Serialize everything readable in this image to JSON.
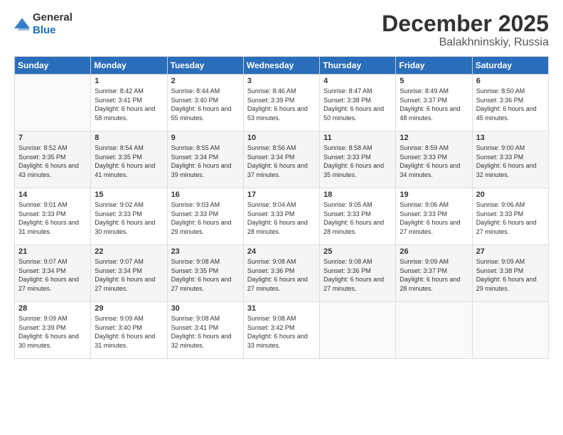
{
  "logo": {
    "general": "General",
    "blue": "Blue"
  },
  "header": {
    "month": "December 2025",
    "location": "Balakhninskiy, Russia"
  },
  "weekdays": [
    "Sunday",
    "Monday",
    "Tuesday",
    "Wednesday",
    "Thursday",
    "Friday",
    "Saturday"
  ],
  "weeks": [
    [
      {
        "day": "",
        "sunrise": "",
        "sunset": "",
        "daylight": ""
      },
      {
        "day": "1",
        "sunrise": "Sunrise: 8:42 AM",
        "sunset": "Sunset: 3:41 PM",
        "daylight": "Daylight: 6 hours and 58 minutes."
      },
      {
        "day": "2",
        "sunrise": "Sunrise: 8:44 AM",
        "sunset": "Sunset: 3:40 PM",
        "daylight": "Daylight: 6 hours and 55 minutes."
      },
      {
        "day": "3",
        "sunrise": "Sunrise: 8:46 AM",
        "sunset": "Sunset: 3:39 PM",
        "daylight": "Daylight: 6 hours and 53 minutes."
      },
      {
        "day": "4",
        "sunrise": "Sunrise: 8:47 AM",
        "sunset": "Sunset: 3:38 PM",
        "daylight": "Daylight: 6 hours and 50 minutes."
      },
      {
        "day": "5",
        "sunrise": "Sunrise: 8:49 AM",
        "sunset": "Sunset: 3:37 PM",
        "daylight": "Daylight: 6 hours and 48 minutes."
      },
      {
        "day": "6",
        "sunrise": "Sunrise: 8:50 AM",
        "sunset": "Sunset: 3:36 PM",
        "daylight": "Daylight: 6 hours and 45 minutes."
      }
    ],
    [
      {
        "day": "7",
        "sunrise": "Sunrise: 8:52 AM",
        "sunset": "Sunset: 3:35 PM",
        "daylight": "Daylight: 6 hours and 43 minutes."
      },
      {
        "day": "8",
        "sunrise": "Sunrise: 8:54 AM",
        "sunset": "Sunset: 3:35 PM",
        "daylight": "Daylight: 6 hours and 41 minutes."
      },
      {
        "day": "9",
        "sunrise": "Sunrise: 8:55 AM",
        "sunset": "Sunset: 3:34 PM",
        "daylight": "Daylight: 6 hours and 39 minutes."
      },
      {
        "day": "10",
        "sunrise": "Sunrise: 8:56 AM",
        "sunset": "Sunset: 3:34 PM",
        "daylight": "Daylight: 6 hours and 37 minutes."
      },
      {
        "day": "11",
        "sunrise": "Sunrise: 8:58 AM",
        "sunset": "Sunset: 3:33 PM",
        "daylight": "Daylight: 6 hours and 35 minutes."
      },
      {
        "day": "12",
        "sunrise": "Sunrise: 8:59 AM",
        "sunset": "Sunset: 3:33 PM",
        "daylight": "Daylight: 6 hours and 34 minutes."
      },
      {
        "day": "13",
        "sunrise": "Sunrise: 9:00 AM",
        "sunset": "Sunset: 3:33 PM",
        "daylight": "Daylight: 6 hours and 32 minutes."
      }
    ],
    [
      {
        "day": "14",
        "sunrise": "Sunrise: 9:01 AM",
        "sunset": "Sunset: 3:33 PM",
        "daylight": "Daylight: 6 hours and 31 minutes."
      },
      {
        "day": "15",
        "sunrise": "Sunrise: 9:02 AM",
        "sunset": "Sunset: 3:33 PM",
        "daylight": "Daylight: 6 hours and 30 minutes."
      },
      {
        "day": "16",
        "sunrise": "Sunrise: 9:03 AM",
        "sunset": "Sunset: 3:33 PM",
        "daylight": "Daylight: 6 hours and 29 minutes."
      },
      {
        "day": "17",
        "sunrise": "Sunrise: 9:04 AM",
        "sunset": "Sunset: 3:33 PM",
        "daylight": "Daylight: 6 hours and 28 minutes."
      },
      {
        "day": "18",
        "sunrise": "Sunrise: 9:05 AM",
        "sunset": "Sunset: 3:33 PM",
        "daylight": "Daylight: 6 hours and 28 minutes."
      },
      {
        "day": "19",
        "sunrise": "Sunrise: 9:06 AM",
        "sunset": "Sunset: 3:33 PM",
        "daylight": "Daylight: 6 hours and 27 minutes."
      },
      {
        "day": "20",
        "sunrise": "Sunrise: 9:06 AM",
        "sunset": "Sunset: 3:33 PM",
        "daylight": "Daylight: 6 hours and 27 minutes."
      }
    ],
    [
      {
        "day": "21",
        "sunrise": "Sunrise: 9:07 AM",
        "sunset": "Sunset: 3:34 PM",
        "daylight": "Daylight: 6 hours and 27 minutes."
      },
      {
        "day": "22",
        "sunrise": "Sunrise: 9:07 AM",
        "sunset": "Sunset: 3:34 PM",
        "daylight": "Daylight: 6 hours and 27 minutes."
      },
      {
        "day": "23",
        "sunrise": "Sunrise: 9:08 AM",
        "sunset": "Sunset: 3:35 PM",
        "daylight": "Daylight: 6 hours and 27 minutes."
      },
      {
        "day": "24",
        "sunrise": "Sunrise: 9:08 AM",
        "sunset": "Sunset: 3:36 PM",
        "daylight": "Daylight: 6 hours and 27 minutes."
      },
      {
        "day": "25",
        "sunrise": "Sunrise: 9:08 AM",
        "sunset": "Sunset: 3:36 PM",
        "daylight": "Daylight: 6 hours and 27 minutes."
      },
      {
        "day": "26",
        "sunrise": "Sunrise: 9:09 AM",
        "sunset": "Sunset: 3:37 PM",
        "daylight": "Daylight: 6 hours and 28 minutes."
      },
      {
        "day": "27",
        "sunrise": "Sunrise: 9:09 AM",
        "sunset": "Sunset: 3:38 PM",
        "daylight": "Daylight: 6 hours and 29 minutes."
      }
    ],
    [
      {
        "day": "28",
        "sunrise": "Sunrise: 9:09 AM",
        "sunset": "Sunset: 3:39 PM",
        "daylight": "Daylight: 6 hours and 30 minutes."
      },
      {
        "day": "29",
        "sunrise": "Sunrise: 9:09 AM",
        "sunset": "Sunset: 3:40 PM",
        "daylight": "Daylight: 6 hours and 31 minutes."
      },
      {
        "day": "30",
        "sunrise": "Sunrise: 9:08 AM",
        "sunset": "Sunset: 3:41 PM",
        "daylight": "Daylight: 6 hours and 32 minutes."
      },
      {
        "day": "31",
        "sunrise": "Sunrise: 9:08 AM",
        "sunset": "Sunset: 3:42 PM",
        "daylight": "Daylight: 6 hours and 33 minutes."
      },
      {
        "day": "",
        "sunrise": "",
        "sunset": "",
        "daylight": ""
      },
      {
        "day": "",
        "sunrise": "",
        "sunset": "",
        "daylight": ""
      },
      {
        "day": "",
        "sunrise": "",
        "sunset": "",
        "daylight": ""
      }
    ]
  ]
}
